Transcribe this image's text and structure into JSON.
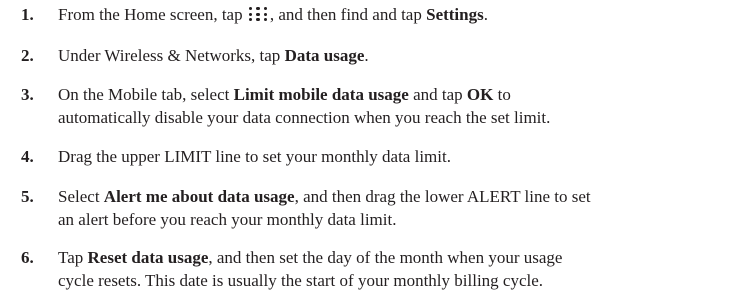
{
  "steps": [
    {
      "number": "1.",
      "line1": {
        "t1": "From the Home screen, tap ",
        "icon": "apps-grid-icon",
        "t2": ", and then find and tap ",
        "b1": "Settings",
        "t3": "."
      }
    },
    {
      "number": "2.",
      "line1": {
        "t1": "Under Wireless & Networks, tap ",
        "b1": "Data usage",
        "t2": "."
      }
    },
    {
      "number": "3.",
      "line1": {
        "t1": "On the Mobile tab, select ",
        "b1": "Limit mobile data usage",
        "t2": " and tap ",
        "b2": "OK",
        "t3": " to"
      },
      "line2": "automatically disable your data connection when you reach the set limit."
    },
    {
      "number": "4.",
      "line1": "Drag the upper LIMIT line to set your monthly data limit."
    },
    {
      "number": "5.",
      "line1": {
        "t1": "Select ",
        "b1": "Alert me about data usage",
        "t2": ", and then drag the lower ALERT line to set"
      },
      "line2": "an alert before you reach your monthly data limit."
    },
    {
      "number": "6.",
      "line1": {
        "t1": "Tap ",
        "b1": "Reset data usage",
        "t2": ", and then set the day of the month when your usage"
      },
      "line2": "cycle resets. This date is usually the start of your monthly billing cycle."
    }
  ]
}
